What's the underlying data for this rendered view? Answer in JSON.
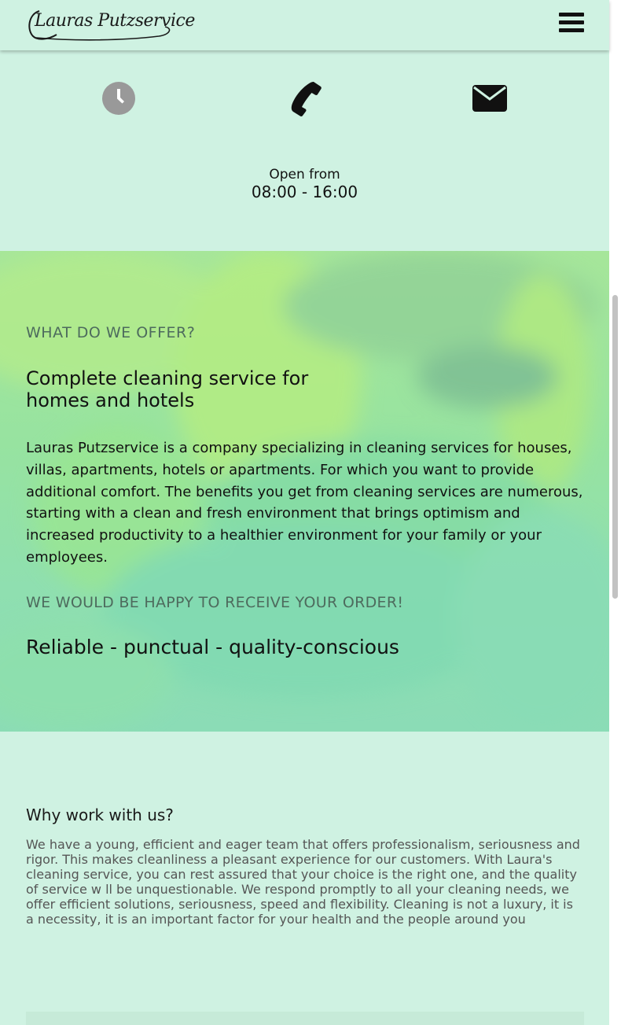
{
  "header": {
    "logo_text": "Lauras Putzservice",
    "menu_icon": "hamburger-menu-icon"
  },
  "contact": {
    "icons": [
      "clock-icon",
      "phone-icon",
      "mail-icon"
    ],
    "open_label": "Open from",
    "open_hours": "08:00 - 16:00"
  },
  "hero": {
    "kicker": "WHAT DO WE OFFER?",
    "title": "Complete cleaning service for homes and hotels",
    "text": "Lauras Putzservice is a company specializing in cleaning services for houses, villas, apartments, hotels or apartments. For which you want to provide additional comfort. The benefits you get from cleaning services are numerous, starting with a clean and fresh environment that brings optimism and increased productivity to a healthier environment for your family or your employees.",
    "kicker2": "WE WOULD BE HAPPY TO RECEIVE YOUR ORDER!",
    "slogan": "Reliable - punctual - quality-conscious"
  },
  "why": {
    "title": "Why work with us?",
    "text": "We have a young, efficient and eager team that offers professionalism, seriousness and rigor. This makes cleanliness a pleasant experience for our customers. With Laura's cleaning service, you can rest assured that your choice is the right one, and the quality of service w ll be unquestionable. We respond promptly to all your cleaning needs, we offer efficient solutions, seriousness, speed and flexibility. Cleaning is not a luxury, it is a necessity, it is an important factor for your health and the people around you"
  },
  "colors": {
    "background": "#cff2e2",
    "hero_green": "#a6e69a",
    "kicker_text": "#4d6b5d",
    "clock_grey": "#999999"
  }
}
